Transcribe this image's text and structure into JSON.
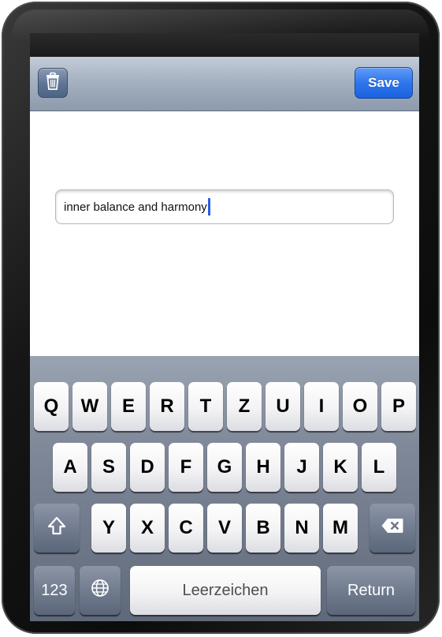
{
  "toolbar": {
    "trash_icon": "trash-icon",
    "save_label": "Save"
  },
  "editor": {
    "text_value": "inner balance and harmony"
  },
  "keyboard": {
    "row1": [
      "Q",
      "W",
      "E",
      "R",
      "T",
      "Z",
      "U",
      "I",
      "O",
      "P"
    ],
    "row2": [
      "A",
      "S",
      "D",
      "F",
      "G",
      "H",
      "J",
      "K",
      "L"
    ],
    "row3": [
      "Y",
      "X",
      "C",
      "V",
      "B",
      "N",
      "M"
    ],
    "shift_icon": "shift-icon",
    "backspace_icon": "backspace-icon",
    "globe_icon": "globe-icon",
    "numbers_label": "123",
    "space_label": "Leerzeichen",
    "return_label": "Return"
  },
  "colors": {
    "save_button": "#2f76ec",
    "caret": "#2a5ee8",
    "navbar": "#a5b1c1",
    "keyboard_bg": "#7e8898"
  }
}
